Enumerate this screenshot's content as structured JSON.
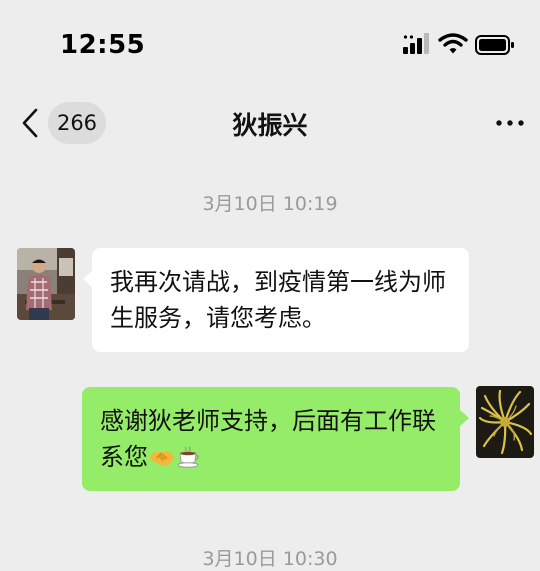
{
  "status_bar": {
    "time": "12:55",
    "icons": [
      "signal-icon",
      "wifi-icon",
      "battery-icon"
    ]
  },
  "nav": {
    "back_icon": "chevron-left-icon",
    "unread_count": "266",
    "title": "狄振兴",
    "more_icon": "more-dots-icon"
  },
  "messages": [
    {
      "timestamp": "3月10日 10:19"
    },
    {
      "direction": "incoming",
      "avatar": "contact-avatar",
      "text": "我再次请战，到疫情第一线为师生服务，请您考虑。"
    },
    {
      "direction": "outgoing",
      "avatar": "self-avatar",
      "text": "感谢狄老师支持，后面有工作联系您",
      "emojis": [
        "handshake-emoji-icon",
        "coffee-emoji-icon"
      ]
    },
    {
      "timestamp": "3月10日 10:30"
    }
  ],
  "colors": {
    "background": "#ededed",
    "incoming_bubble": "#ffffff",
    "outgoing_bubble": "#95ec69",
    "timestamp_text": "#9a9a9a",
    "badge_bg": "#dcdcdc"
  }
}
